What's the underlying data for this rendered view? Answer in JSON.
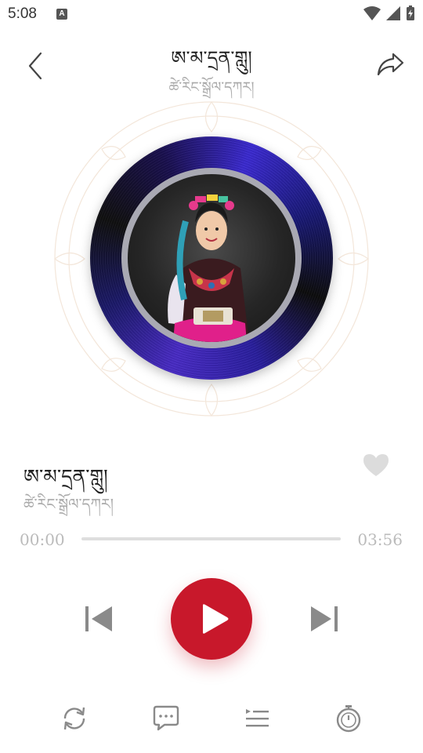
{
  "status_bar": {
    "time": "5:08",
    "notification_icon": "A"
  },
  "header": {
    "title": "ཨ་མ་དྲན་གླུ།",
    "artist": "ཚེ་རིང་སྒྲོལ་དཀར།",
    "back_icon": "chevron-left-icon",
    "share_icon": "share-icon"
  },
  "song": {
    "title": "ཨ་མ་དྲན་གླུ།",
    "artist": "ཚེ་རིང་སྒྲོལ་དཀར།",
    "liked": false
  },
  "progress": {
    "current": "00:00",
    "total": "03:56",
    "fraction": 0
  },
  "controls": {
    "prev_icon": "skip-previous-icon",
    "play_icon": "play-icon",
    "next_icon": "skip-next-icon"
  },
  "bottom_bar": [
    "repeat-icon",
    "comment-icon",
    "playlist-icon",
    "timer-icon"
  ],
  "colors": {
    "accent": "#c8182b",
    "muted_text": "#aaaaaa",
    "icon": "#8a8a8a"
  }
}
